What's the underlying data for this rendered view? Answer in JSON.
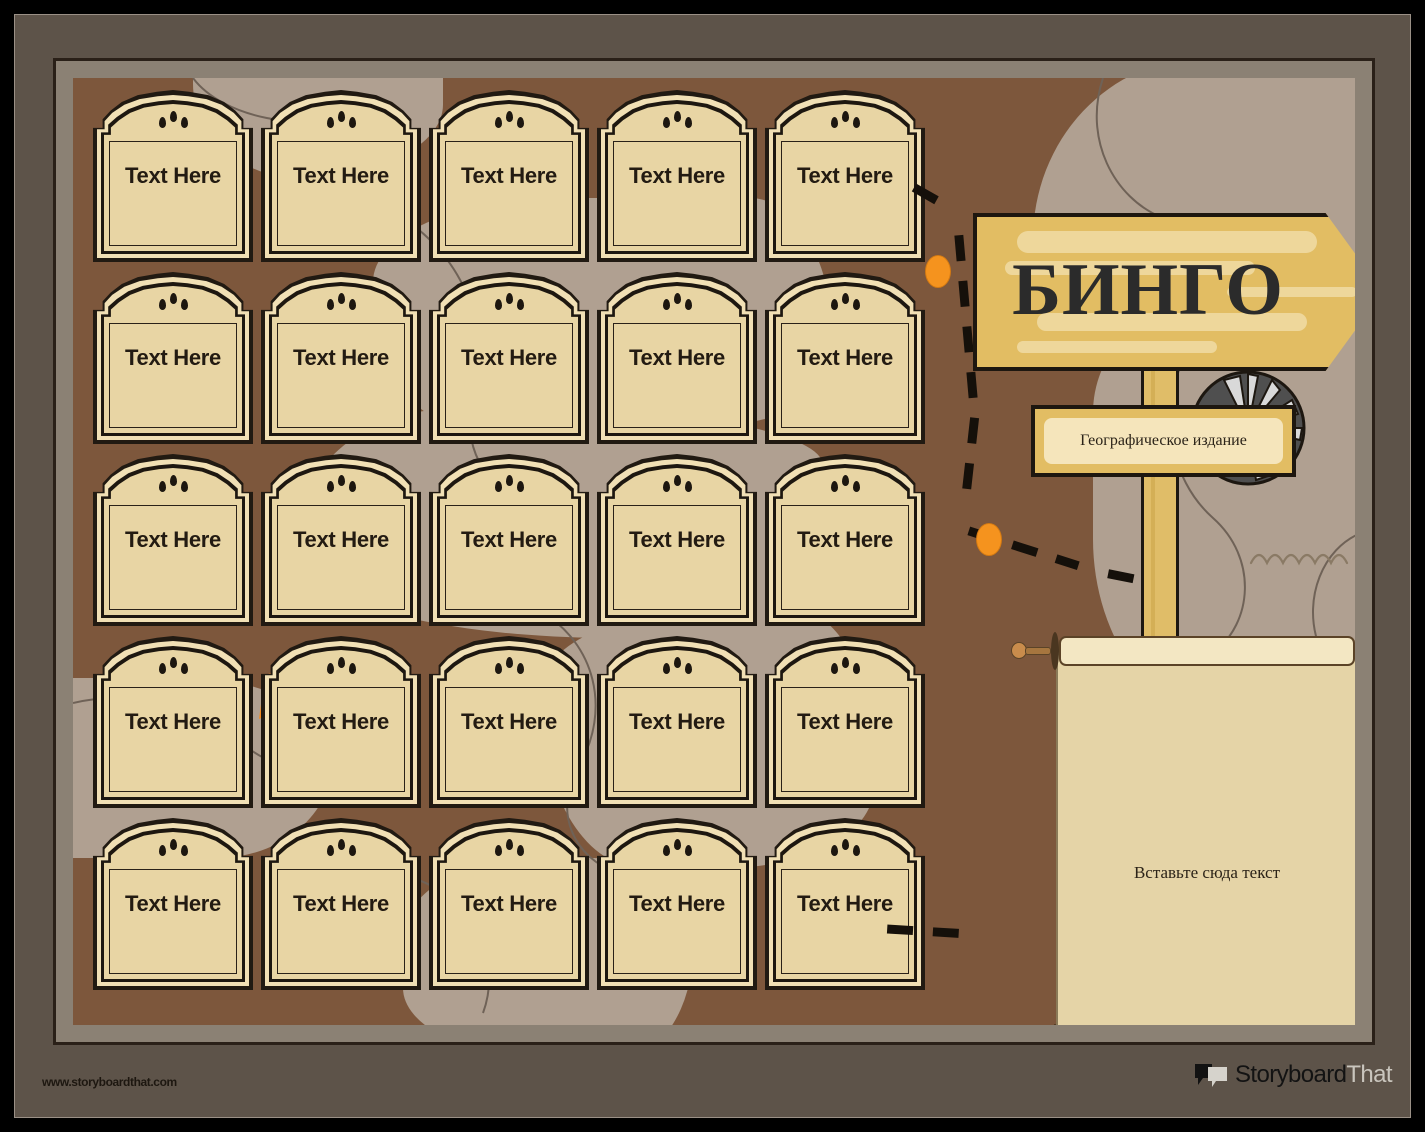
{
  "poster": {
    "title": "БИНГО",
    "subtitle": "Географическое издание",
    "scroll_text": "Вставьте сюда текст",
    "grid": {
      "rows": 5,
      "cols": 5,
      "cell_label": "Text Here",
      "cells": [
        [
          "Text Here",
          "Text Here",
          "Text Here",
          "Text Here",
          "Text Here"
        ],
        [
          "Text Here",
          "Text Here",
          "Text Here",
          "Text Here",
          "Text Here"
        ],
        [
          "Text Here",
          "Text Here",
          "Text Here",
          "Text Here",
          "Text Here"
        ],
        [
          "Text Here",
          "Text Here",
          "Text Here",
          "Text Here",
          "Text Here"
        ],
        [
          "Text Here",
          "Text Here",
          "Text Here",
          "Text Here",
          "Text Here"
        ]
      ]
    }
  },
  "footer": {
    "url": "www.storyboardthat.com",
    "brand_primary": "Storyboard",
    "brand_secondary": "That"
  },
  "colors": {
    "frame_outer": "#5d5349",
    "frame_inner": "#8b8174",
    "map_base": "#7d573c",
    "terrain": "#b0a091",
    "cell_face": "#e8d5a4",
    "cell_border": "#211a12",
    "sign_wood": "#e2bd63",
    "sign_highlight": "#f0dca4",
    "marker_orange": "#f5931e",
    "splash_orange": "#f58a1f",
    "scroll_paper": "#e5d4a7"
  }
}
